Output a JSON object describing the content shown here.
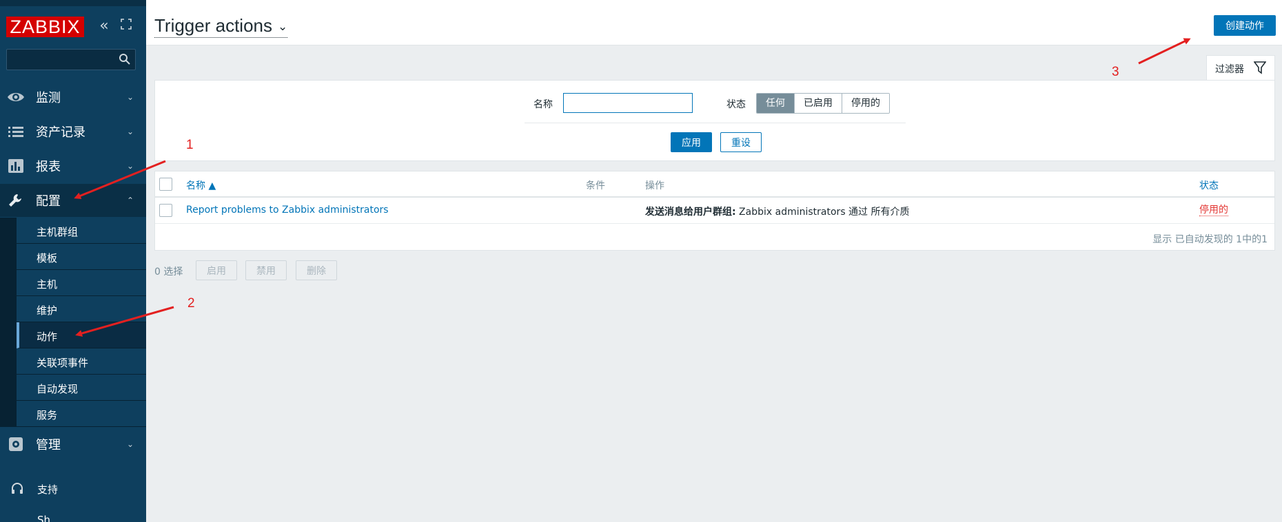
{
  "sidebar": {
    "logo": "ZABBIX",
    "menu": [
      {
        "label": "监测",
        "icon": "eye-icon"
      },
      {
        "label": "资产记录",
        "icon": "list-icon"
      },
      {
        "label": "报表",
        "icon": "bar-chart-icon"
      },
      {
        "label": "配置",
        "icon": "wrench-icon"
      },
      {
        "label": "管理",
        "icon": "gear-icon"
      }
    ],
    "submenu": [
      "主机群组",
      "模板",
      "主机",
      "维护",
      "动作",
      "关联项事件",
      "自动发现",
      "服务"
    ],
    "support": "支持",
    "share": "Sh..."
  },
  "header": {
    "title": "Trigger actions",
    "create_button": "创建动作"
  },
  "filter": {
    "tab_label": "过滤器",
    "name_label": "名称",
    "name_value": "",
    "status_label": "状态",
    "status_options": [
      "任何",
      "已启用",
      "停用的"
    ],
    "status_selected": "任何",
    "apply": "应用",
    "reset": "重设"
  },
  "table": {
    "headers": {
      "name": "名称 ▲",
      "conditions": "条件",
      "operations": "操作",
      "status": "状态"
    },
    "rows": [
      {
        "name": "Report problems to Zabbix administrators",
        "conditions": "",
        "operations_bold": "发送消息给用户群组:",
        "operations_rest": " Zabbix administrators 通过 所有介质",
        "status": "停用的"
      }
    ],
    "footer": "显示 已自动发现的 1中的1"
  },
  "actions": {
    "selected": "0 选择",
    "enable": "启用",
    "disable": "禁用",
    "delete": "删除"
  },
  "annotations": [
    "1",
    "2",
    "3"
  ],
  "colors": {
    "sidebar": "#0e3f5e",
    "accent": "#0275b8",
    "logo_red": "#d40000",
    "annotation": "#e32020",
    "disabled_status": "#e33734"
  }
}
